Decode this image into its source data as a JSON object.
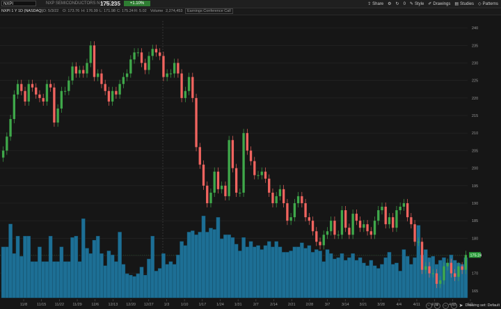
{
  "toolbar": {
    "symbol_value": "NXPI",
    "company_name": "NXP SEMICONDUCTORS N.V. COM",
    "last_price": "175.235",
    "change": "+1.10%",
    "share_label": "Share",
    "style_label": "Style",
    "drawings_label": "Drawings",
    "studies_label": "Studies",
    "patterns_label": "Patterns",
    "count_label": "0"
  },
  "infobar": {
    "chart_title": "NXPI 1 Y 1D (NASDAQ)",
    "date": "D: 5/3/22",
    "open": "O: 173.76",
    "high": "H: 176.99",
    "low": "L: 171.98",
    "close": "C: 175.24",
    "change": "R: 5.02",
    "volume_label": "Volume",
    "volume_value": "2,274,453",
    "study_label": "Earnings Conference Call"
  },
  "status": {
    "drawing_set": "Drawing set: Default"
  },
  "colors": {
    "up": "#3fa84a",
    "down": "#f0645f",
    "volume": "#1d6f95",
    "background": "#161616",
    "grid": "#262626",
    "last_price_tag": "#2a9d3a"
  },
  "chart_data": {
    "type": "candlestick",
    "title": "NXPI 1 Y 1D (NASDAQ)",
    "ylim": [
      163,
      242
    ],
    "y_ticks": [
      165,
      170,
      175,
      180,
      185,
      190,
      195,
      200,
      205,
      210,
      215,
      220,
      225,
      230,
      235,
      240
    ],
    "x_ticks": [
      "11/8",
      "11/15",
      "11/22",
      "11/29",
      "12/6",
      "12/13",
      "12/20",
      "12/27",
      "1/3",
      "1/10",
      "1/17",
      "1/24",
      "1/31",
      "2/7",
      "2/14",
      "2/21",
      "2/28",
      "3/7",
      "3/14",
      "3/21",
      "3/28",
      "4/4",
      "4/11",
      "4/18",
      "4/25",
      "5/2"
    ],
    "last_price_label": "175.24",
    "closes": [
      205,
      209,
      214,
      221,
      224,
      222,
      219,
      224,
      223,
      221,
      220,
      219,
      224,
      223,
      213,
      217,
      222,
      222,
      225,
      229,
      227,
      228,
      227,
      230,
      235,
      226,
      227,
      224,
      222,
      219,
      222,
      221,
      224,
      226,
      227,
      231,
      233,
      233,
      230,
      228,
      232,
      234,
      233,
      232,
      226,
      227,
      227,
      230,
      227,
      220,
      222,
      226,
      220,
      206,
      201,
      195,
      190,
      193,
      199,
      194,
      195,
      192,
      208,
      200,
      193,
      193,
      210,
      205,
      202,
      198,
      198,
      199,
      197,
      193,
      190,
      192,
      194,
      190,
      185,
      186,
      190,
      192,
      190,
      186,
      185,
      182,
      179,
      178,
      181,
      182,
      185,
      181,
      181,
      188,
      183,
      181,
      187,
      185,
      183,
      184,
      182,
      181,
      185,
      188,
      189,
      184,
      186,
      183,
      188,
      189,
      190,
      186,
      184,
      179,
      179,
      171,
      172,
      170,
      170,
      167,
      168,
      172,
      173,
      170,
      169,
      172,
      171,
      175.24
    ],
    "volume_pct": [
      0.38,
      0.38,
      0.55,
      0.33,
      0.46,
      0.31,
      0.46,
      0.46,
      0.27,
      0.27,
      0.38,
      0.27,
      0.27,
      0.46,
      0.27,
      0.27,
      0.38,
      0.27,
      0.27,
      0.45,
      0.46,
      0.27,
      0.59,
      0.37,
      0.33,
      0.43,
      0.46,
      0.33,
      0.24,
      0.35,
      0.32,
      0.27,
      0.49,
      0.25,
      0.18,
      0.17,
      0.16,
      0.18,
      0.23,
      0.17,
      0.29,
      0.46,
      0.2,
      0.22,
      0.33,
      0.25,
      0.27,
      0.25,
      0.32,
      0.42,
      0.39,
      0.49,
      0.5,
      0.47,
      0.49,
      0.61,
      0.49,
      0.52,
      0.51,
      0.6,
      0.44,
      0.47,
      0.47,
      0.45,
      0.4,
      0.35,
      0.45,
      0.38,
      0.42,
      0.38,
      0.39,
      0.36,
      0.39,
      0.42,
      0.38,
      0.42,
      0.38,
      0.34,
      0.34,
      0.35,
      0.38,
      0.38,
      0.41,
      0.37,
      0.39,
      0.34,
      0.36,
      0.35,
      0.27,
      0.36,
      0.33,
      0.29,
      0.3,
      0.33,
      0.28,
      0.3,
      0.33,
      0.28,
      0.3,
      0.26,
      0.24,
      0.28,
      0.24,
      0.22,
      0.25,
      0.3,
      0.34,
      0.25,
      0.26,
      0.2,
      0.36,
      0.31,
      0.25,
      0.3,
      0.54,
      0.32,
      0.36,
      0.3,
      0.31,
      0.25,
      0.28,
      0.3,
      0.26,
      0.32,
      0.28,
      0.26,
      0.25,
      0.3
    ]
  }
}
